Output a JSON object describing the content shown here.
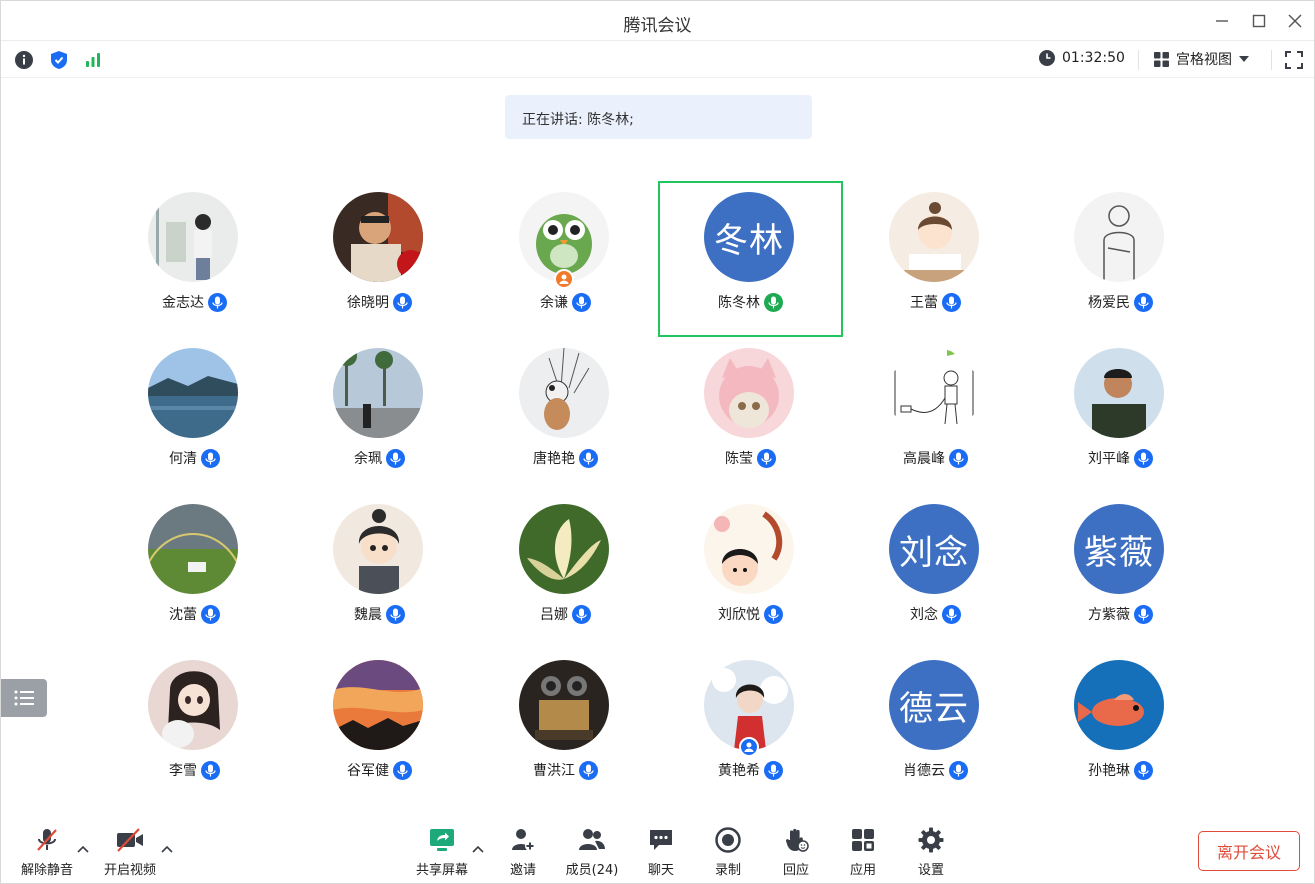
{
  "app": {
    "title": "腾讯会议"
  },
  "infobar": {
    "timer": "01:32:50",
    "view_label": "宫格视图"
  },
  "speaking": {
    "text": "正在讲话: 陈冬林;"
  },
  "participants": [
    {
      "name": "金志达",
      "avatar": "photo",
      "avatar_text": "",
      "mic": "blue"
    },
    {
      "name": "徐晓明",
      "avatar": "photo",
      "avatar_text": "",
      "mic": "blue"
    },
    {
      "name": "余谦",
      "avatar": "photo",
      "avatar_text": "",
      "mic": "blue",
      "badge": "user-icon-orange"
    },
    {
      "name": "陈冬林",
      "avatar": "text",
      "avatar_text": "冬林",
      "mic": "green",
      "active": true
    },
    {
      "name": "王蕾",
      "avatar": "photo",
      "avatar_text": "",
      "mic": "blue"
    },
    {
      "name": "杨爱民",
      "avatar": "photo",
      "avatar_text": "",
      "mic": "blue"
    },
    {
      "name": "何清",
      "avatar": "photo",
      "avatar_text": "",
      "mic": "blue"
    },
    {
      "name": "余珮",
      "avatar": "photo",
      "avatar_text": "",
      "mic": "blue"
    },
    {
      "name": "唐艳艳",
      "avatar": "photo",
      "avatar_text": "",
      "mic": "blue"
    },
    {
      "name": "陈莹",
      "avatar": "photo",
      "avatar_text": "",
      "mic": "blue"
    },
    {
      "name": "高晨峰",
      "avatar": "photo",
      "avatar_text": "",
      "mic": "blue"
    },
    {
      "name": "刘平峰",
      "avatar": "photo",
      "avatar_text": "",
      "mic": "blue"
    },
    {
      "name": "沈蕾",
      "avatar": "photo",
      "avatar_text": "",
      "mic": "blue"
    },
    {
      "name": "魏晨",
      "avatar": "photo",
      "avatar_text": "",
      "mic": "blue"
    },
    {
      "name": "吕娜",
      "avatar": "photo",
      "avatar_text": "",
      "mic": "blue"
    },
    {
      "name": "刘欣悦",
      "avatar": "photo",
      "avatar_text": "",
      "mic": "blue"
    },
    {
      "name": "刘念",
      "avatar": "text",
      "avatar_text": "刘念",
      "mic": "blue"
    },
    {
      "name": "方紫薇",
      "avatar": "text",
      "avatar_text": "紫薇",
      "mic": "blue"
    },
    {
      "name": "李雪",
      "avatar": "photo",
      "avatar_text": "",
      "mic": "blue"
    },
    {
      "name": "谷军健",
      "avatar": "photo",
      "avatar_text": "",
      "mic": "blue"
    },
    {
      "name": "曹洪江",
      "avatar": "photo",
      "avatar_text": "",
      "mic": "blue"
    },
    {
      "name": "黄艳希",
      "avatar": "photo",
      "avatar_text": "",
      "mic": "blue",
      "badge": "user-icon-blue"
    },
    {
      "name": "肖德云",
      "avatar": "text",
      "avatar_text": "德云",
      "mic": "blue"
    },
    {
      "name": "孙艳琳",
      "avatar": "photo",
      "avatar_text": "",
      "mic": "blue"
    }
  ],
  "toolbar": {
    "unmute": "解除静音",
    "start_video": "开启视频",
    "share_screen": "共享屏幕",
    "invite": "邀请",
    "members": "成员(24)",
    "chat": "聊天",
    "record": "录制",
    "react": "回应",
    "apps": "应用",
    "settings": "设置",
    "leave": "离开会议"
  },
  "colors": {
    "accent": "#1a6cf5",
    "active_border": "#22c55e",
    "avatar_bg": "#3d6fc2",
    "leave": "#e04b3a"
  }
}
